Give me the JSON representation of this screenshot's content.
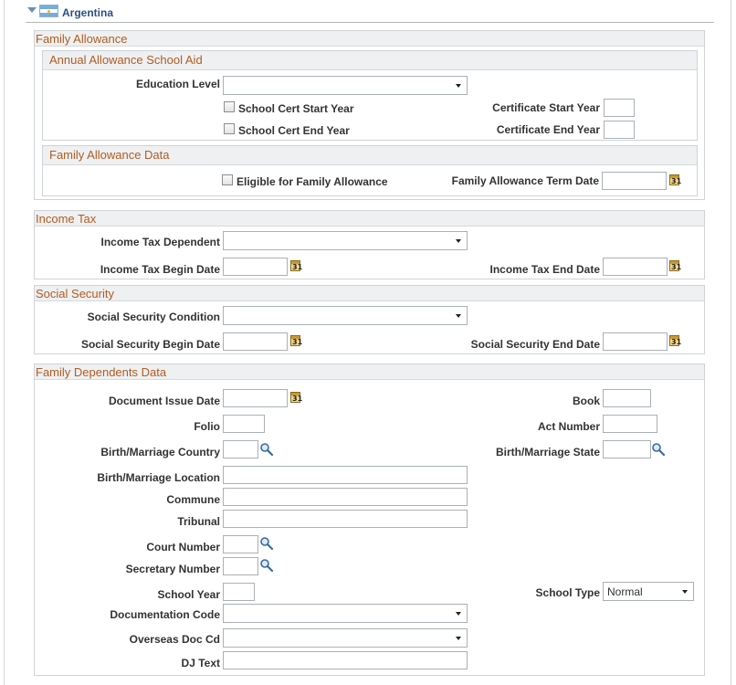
{
  "country": "Argentina",
  "family_allowance": {
    "title": "Family Allowance",
    "annual_aid": {
      "title": "Annual Allowance School Aid",
      "education_level_label": "Education Level",
      "education_level_value": "",
      "school_cert_start_label": "School Cert Start Year",
      "school_cert_end_label": "School Cert End Year",
      "cert_start_year_label": "Certificate Start Year",
      "cert_end_year_label": "Certificate End Year"
    },
    "data": {
      "title": "Family Allowance Data",
      "eligible_label": "Eligible for Family Allowance",
      "term_date_label": "Family Allowance Term Date"
    }
  },
  "income_tax": {
    "title": "Income Tax",
    "dependent_label": "Income Tax Dependent",
    "dependent_value": "",
    "begin_date_label": "Income Tax Begin Date",
    "end_date_label": "Income Tax End Date"
  },
  "social_security": {
    "title": "Social Security",
    "condition_label": "Social Security Condition",
    "condition_value": "",
    "begin_date_label": "Social Security Begin Date",
    "end_date_label": "Social Security End Date"
  },
  "dependents": {
    "title": "Family Dependents Data",
    "document_issue_date_label": "Document Issue Date",
    "book_label": "Book",
    "folio_label": "Folio",
    "act_number_label": "Act Number",
    "birth_country_label": "Birth/Marriage Country",
    "birth_state_label": "Birth/Marriage State",
    "birth_location_label": "Birth/Marriage Location",
    "commune_label": "Commune",
    "tribunal_label": "Tribunal",
    "court_number_label": "Court Number",
    "secretary_number_label": "Secretary Number",
    "school_year_label": "School Year",
    "school_type_label": "School Type",
    "school_type_value": "Normal",
    "documentation_code_label": "Documentation Code",
    "documentation_code_value": "",
    "overseas_doc_label": "Overseas Doc Cd",
    "overseas_doc_value": "",
    "dj_text_label": "DJ Text"
  },
  "icons": {
    "calendar": "calendar-icon",
    "lookup": "magnifier-icon",
    "collapse": "triangle-down-icon",
    "flag": "argentina-flag-icon"
  }
}
